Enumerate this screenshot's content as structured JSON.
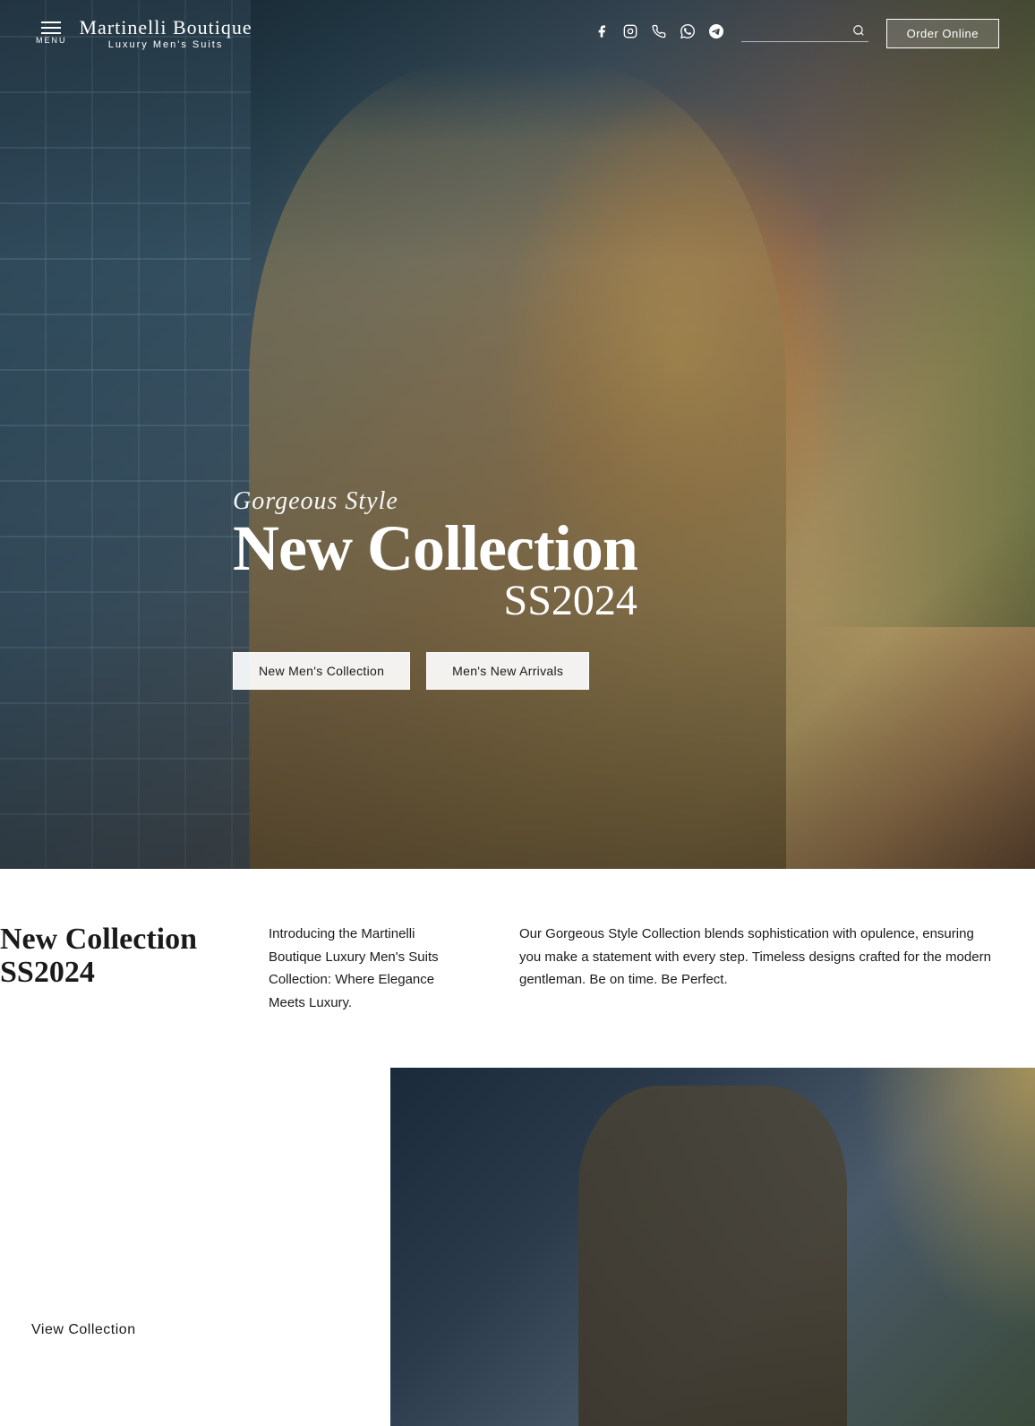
{
  "brand": {
    "name": "Martinelli Boutique",
    "tagline": "Luxury Men's Suits"
  },
  "header": {
    "menu_label": "MENU",
    "order_btn": "Order Online",
    "search_placeholder": ""
  },
  "social": {
    "facebook": "f",
    "instagram": "◎",
    "phone": "☎",
    "whatsapp": "✆",
    "telegram": "➤"
  },
  "hero": {
    "subtitle": "Gorgeous Style",
    "title": "New Collection",
    "year": "SS2024",
    "btn1": "New Men's Collection",
    "btn2": "Men's New Arrivals"
  },
  "description": {
    "heading_line1": "New Collection",
    "heading_line2": "SS2024",
    "intro": "Introducing the Martinelli Boutique Luxury Men's Suits Collection:  Where Elegance Meets Luxury.",
    "body": "Our Gorgeous Style Collection blends sophistication with opulence, ensuring you make a statement with every step. Timeless designs crafted for the modern gentleman. Be on time. Be Perfect."
  },
  "second_section": {
    "view_collection_btn": "View Collection"
  }
}
